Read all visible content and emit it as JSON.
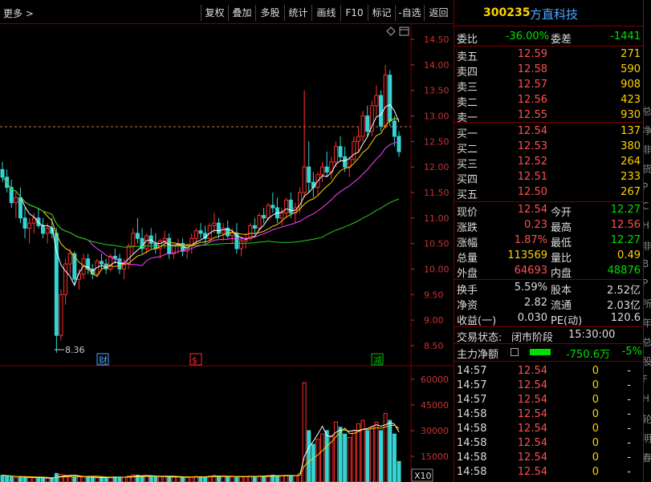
{
  "toolbar": {
    "more": "更多 >",
    "buttons": [
      "复权",
      "叠加",
      "多股",
      "统计",
      "画线",
      "F10",
      "标记",
      "-自选",
      "返回"
    ]
  },
  "chart": {
    "price_ticks": [
      "14.50",
      "14.00",
      "13.50",
      "13.00",
      "12.50",
      "12.00",
      "11.50",
      "11.00",
      "10.50",
      "10.00",
      "9.50",
      "9.00",
      "8.50"
    ],
    "low_marker": "8.36",
    "events": [
      {
        "label": "财",
        "color": "#4aa8ff"
      },
      {
        "label": "$",
        "color": "#ff3030"
      },
      {
        "label": "减",
        "color": "#00c000"
      }
    ],
    "volume_ticks": [
      "60000",
      "45000",
      "30000",
      "15000"
    ],
    "volume_unit": "X10"
  },
  "chart_data": {
    "type": "candlestick",
    "ylim": [
      8.2,
      14.8
    ],
    "close_reference": 12.9,
    "candles": [
      [
        11.95,
        12.1,
        11.7,
        11.8
      ],
      [
        11.8,
        11.95,
        11.5,
        11.6
      ],
      [
        11.6,
        11.75,
        11.2,
        11.3
      ],
      [
        11.3,
        11.5,
        11.0,
        11.4
      ],
      [
        11.4,
        11.6,
        10.9,
        11.0
      ],
      [
        11.0,
        11.2,
        10.6,
        10.8
      ],
      [
        10.8,
        11.0,
        10.5,
        10.9
      ],
      [
        10.9,
        11.1,
        10.7,
        11.0
      ],
      [
        11.0,
        11.2,
        10.8,
        10.85
      ],
      [
        10.85,
        11.0,
        10.6,
        10.7
      ],
      [
        10.7,
        10.9,
        10.5,
        10.8
      ],
      [
        10.8,
        11.0,
        10.6,
        10.7
      ],
      [
        10.7,
        10.8,
        8.36,
        8.7
      ],
      [
        8.7,
        9.6,
        8.6,
        9.5
      ],
      [
        9.5,
        10.2,
        9.3,
        10.1
      ],
      [
        10.1,
        10.4,
        9.9,
        10.3
      ],
      [
        10.3,
        10.35,
        9.7,
        9.8
      ],
      [
        9.8,
        10.0,
        9.6,
        9.9
      ],
      [
        9.9,
        10.3,
        9.8,
        10.2
      ],
      [
        10.2,
        10.3,
        9.9,
        10.0
      ],
      [
        10.0,
        10.1,
        9.8,
        9.9
      ],
      [
        9.9,
        10.2,
        9.85,
        10.15
      ],
      [
        10.15,
        10.3,
        10.0,
        10.1
      ],
      [
        10.1,
        10.2,
        9.9,
        10.0
      ],
      [
        10.0,
        10.3,
        9.95,
        10.25
      ],
      [
        10.25,
        10.4,
        10.1,
        10.2
      ],
      [
        10.2,
        10.3,
        9.9,
        10.0
      ],
      [
        10.0,
        10.2,
        9.8,
        10.1
      ],
      [
        10.1,
        10.5,
        10.0,
        10.45
      ],
      [
        10.45,
        10.8,
        10.3,
        10.7
      ],
      [
        10.7,
        11.0,
        10.5,
        10.6
      ],
      [
        10.6,
        10.8,
        10.3,
        10.4
      ],
      [
        10.4,
        10.7,
        10.3,
        10.65
      ],
      [
        10.65,
        10.8,
        10.4,
        10.5
      ],
      [
        10.5,
        10.7,
        10.3,
        10.4
      ],
      [
        10.4,
        10.6,
        10.2,
        10.55
      ],
      [
        10.55,
        10.75,
        10.4,
        10.6
      ],
      [
        10.6,
        10.7,
        10.2,
        10.3
      ],
      [
        10.3,
        10.5,
        10.2,
        10.45
      ],
      [
        10.45,
        10.6,
        10.3,
        10.5
      ],
      [
        10.5,
        10.6,
        10.25,
        10.35
      ],
      [
        10.35,
        10.5,
        10.2,
        10.45
      ],
      [
        10.45,
        10.7,
        10.3,
        10.6
      ],
      [
        10.6,
        10.8,
        10.5,
        10.75
      ],
      [
        10.75,
        10.9,
        10.6,
        10.7
      ],
      [
        10.7,
        10.85,
        10.5,
        10.6
      ],
      [
        10.6,
        10.9,
        10.55,
        10.85
      ],
      [
        10.85,
        11.1,
        10.7,
        10.9
      ],
      [
        10.9,
        11.0,
        10.6,
        10.7
      ],
      [
        10.7,
        10.9,
        10.55,
        10.8
      ],
      [
        10.8,
        10.95,
        10.6,
        10.65
      ],
      [
        10.65,
        10.8,
        10.5,
        10.7
      ],
      [
        10.7,
        10.9,
        10.3,
        10.4
      ],
      [
        10.4,
        10.6,
        10.25,
        10.55
      ],
      [
        10.55,
        10.7,
        10.4,
        10.6
      ],
      [
        10.6,
        10.9,
        10.55,
        10.85
      ],
      [
        10.85,
        11.0,
        10.7,
        10.8
      ],
      [
        10.8,
        11.1,
        10.75,
        11.05
      ],
      [
        11.05,
        11.2,
        10.9,
        11.0
      ],
      [
        11.0,
        11.3,
        10.95,
        11.25
      ],
      [
        11.25,
        11.5,
        11.1,
        11.2
      ],
      [
        11.2,
        11.4,
        10.9,
        11.0
      ],
      [
        11.0,
        11.2,
        10.85,
        11.1
      ],
      [
        11.1,
        11.4,
        11.0,
        11.35
      ],
      [
        11.35,
        11.5,
        11.0,
        11.1
      ],
      [
        11.1,
        11.3,
        10.9,
        11.2
      ],
      [
        11.2,
        11.6,
        11.1,
        11.5
      ],
      [
        11.5,
        13.5,
        11.4,
        12.0
      ],
      [
        12.0,
        12.5,
        11.5,
        11.7
      ],
      [
        11.7,
        11.9,
        11.4,
        11.6
      ],
      [
        11.6,
        11.9,
        11.45,
        11.85
      ],
      [
        11.85,
        12.1,
        11.7,
        12.0
      ],
      [
        12.0,
        12.3,
        11.8,
        11.9
      ],
      [
        11.9,
        12.2,
        11.75,
        12.1
      ],
      [
        12.1,
        12.5,
        12.0,
        12.4
      ],
      [
        12.4,
        12.6,
        12.1,
        12.2
      ],
      [
        12.2,
        12.4,
        11.9,
        12.0
      ],
      [
        12.0,
        12.2,
        11.8,
        12.15
      ],
      [
        12.15,
        12.6,
        12.1,
        12.5
      ],
      [
        12.5,
        12.8,
        12.3,
        12.6
      ],
      [
        12.6,
        13.1,
        12.5,
        13.0
      ],
      [
        13.0,
        13.2,
        12.6,
        12.7
      ],
      [
        12.7,
        13.3,
        12.6,
        13.2
      ],
      [
        13.2,
        13.6,
        13.0,
        13.4
      ],
      [
        13.4,
        13.5,
        12.7,
        12.8
      ],
      [
        12.8,
        14.0,
        12.75,
        13.8
      ],
      [
        13.8,
        13.9,
        12.8,
        12.9
      ],
      [
        12.9,
        13.0,
        12.4,
        12.6
      ],
      [
        12.6,
        12.7,
        12.2,
        12.3
      ]
    ],
    "volumes": [
      4000,
      3500,
      3000,
      2500,
      3000,
      2800,
      2600,
      2500,
      2400,
      2300,
      2200,
      2100,
      5000,
      4500,
      4000,
      3500,
      3200,
      3000,
      2800,
      2700,
      2600,
      2500,
      2700,
      2600,
      2800,
      3000,
      2900,
      2800,
      3500,
      4200,
      4000,
      3600,
      3500,
      3300,
      3100,
      3000,
      3100,
      2900,
      2800,
      3000,
      2800,
      2700,
      3000,
      3300,
      3100,
      3000,
      3400,
      3800,
      3500,
      3300,
      3100,
      3000,
      3200,
      3000,
      3100,
      3400,
      3300,
      3600,
      3500,
      3800,
      4000,
      3700,
      3600,
      3900,
      3700,
      3800,
      5000,
      58000,
      30000,
      22000,
      25000,
      28000,
      30000,
      27000,
      35000,
      32000,
      28000,
      26000,
      30000,
      34000,
      36000,
      30000,
      32000,
      35000,
      30000,
      40000,
      36000,
      28000,
      12000
    ]
  },
  "quote": {
    "code": "300235",
    "name": "方直科技",
    "webi_label": "委比",
    "webi_value": "-36.00%",
    "weicha_label": "委差",
    "weicha_value": "-1441",
    "asks": [
      {
        "label": "卖五",
        "price": "12.59",
        "vol": "271"
      },
      {
        "label": "卖四",
        "price": "12.58",
        "vol": "590"
      },
      {
        "label": "卖三",
        "price": "12.57",
        "vol": "908"
      },
      {
        "label": "卖二",
        "price": "12.56",
        "vol": "423"
      },
      {
        "label": "卖一",
        "price": "12.55",
        "vol": "930"
      }
    ],
    "bids": [
      {
        "label": "买一",
        "price": "12.54",
        "vol": "137"
      },
      {
        "label": "买二",
        "price": "12.53",
        "vol": "380"
      },
      {
        "label": "买三",
        "price": "12.52",
        "vol": "264"
      },
      {
        "label": "买四",
        "price": "12.51",
        "vol": "233"
      },
      {
        "label": "买五",
        "price": "12.50",
        "vol": "267"
      }
    ],
    "stats": [
      {
        "l1": "现价",
        "v1": "12.54",
        "c1": "red",
        "l2": "今开",
        "v2": "12.27",
        "c2": "green"
      },
      {
        "l1": "涨跌",
        "v1": "0.23",
        "c1": "red",
        "l2": "最高",
        "v2": "12.56",
        "c2": "red"
      },
      {
        "l1": "涨幅",
        "v1": "1.87%",
        "c1": "red",
        "l2": "最低",
        "v2": "12.27",
        "c2": "green"
      },
      {
        "l1": "总量",
        "v1": "113569",
        "c1": "yellow",
        "l2": "量比",
        "v2": "0.49",
        "c2": "yellow"
      },
      {
        "l1": "外盘",
        "v1": "64693",
        "c1": "red",
        "l2": "内盘",
        "v2": "48876",
        "c2": "green"
      }
    ],
    "stats2": [
      {
        "l1": "换手",
        "v1": "5.59%",
        "l2": "股本",
        "v2": "2.52亿"
      },
      {
        "l1": "净资",
        "v1": "2.82",
        "l2": "流通",
        "v2": "2.03亿"
      },
      {
        "l1": "收益(一)",
        "v1": "0.030",
        "l2": "PE(动)",
        "v2": "120.6"
      }
    ],
    "trade_status_label": "交易状态:",
    "trade_status_value": "闭市阶段",
    "trade_status_time": "15:30:00",
    "main_flow_label": "主力净额",
    "main_flow_value": "-750.6万",
    "main_flow_pct": "-5%",
    "ticks": [
      {
        "time": "14:57",
        "price": "12.54",
        "vol": "0",
        "dir": "-"
      },
      {
        "time": "14:57",
        "price": "12.54",
        "vol": "0",
        "dir": "-"
      },
      {
        "time": "14:57",
        "price": "12.54",
        "vol": "0",
        "dir": "-"
      },
      {
        "time": "14:58",
        "price": "12.54",
        "vol": "0",
        "dir": "-"
      },
      {
        "time": "14:58",
        "price": "12.54",
        "vol": "0",
        "dir": "-"
      },
      {
        "time": "14:58",
        "price": "12.54",
        "vol": "0",
        "dir": "-"
      },
      {
        "time": "14:58",
        "price": "12.54",
        "vol": "0",
        "dir": "-"
      },
      {
        "time": "14:58",
        "price": "12.54",
        "vol": "0",
        "dir": "-"
      }
    ]
  },
  "edge_chars": [
    "总",
    "净",
    "非",
    "货",
    "P",
    "C",
    "H",
    "非",
    "B",
    "P",
    "所",
    "年",
    "总",
    "股",
    "F",
    "H",
    "轮",
    "明",
    "春"
  ]
}
